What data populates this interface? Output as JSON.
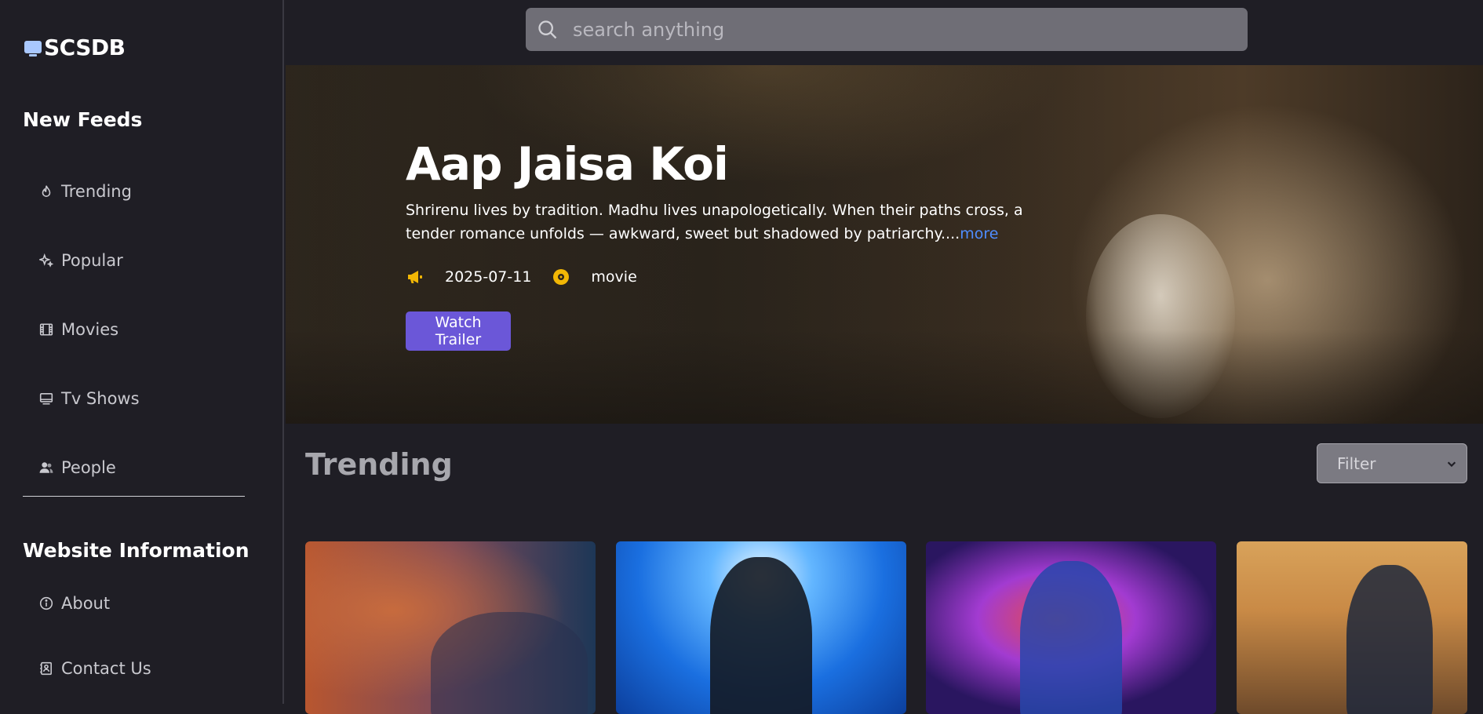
{
  "brand": {
    "name": "SCSDB"
  },
  "sidebar": {
    "feeds_title": "New Feeds",
    "items": [
      {
        "label": "Trending",
        "icon": "flame-icon"
      },
      {
        "label": "Popular",
        "icon": "sparkle-icon"
      },
      {
        "label": "Movies",
        "icon": "film-icon"
      },
      {
        "label": "Tv Shows",
        "icon": "tv-icon"
      },
      {
        "label": "People",
        "icon": "people-icon"
      }
    ],
    "info_title": "Website Information",
    "info_items": [
      {
        "label": "About",
        "icon": "info-icon"
      },
      {
        "label": "Contact Us",
        "icon": "contact-icon"
      }
    ]
  },
  "search": {
    "placeholder": "search anything"
  },
  "hero": {
    "title": "Aap Jaisa Koi",
    "description": "Shrirenu lives by tradition. Madhu lives unapologetically. When their paths cross, a tender romance unfolds — awkward, sweet but shadowed by patriarchy....",
    "more_label": "more",
    "release_date": "2025-07-11",
    "media_type": "movie",
    "watch_label": "Watch Trailer",
    "accent_color": "#6b57d8",
    "icon_color": "#f2b705"
  },
  "trending": {
    "title": "Trending",
    "filter_label": "Filter",
    "cards": [
      {
        "poster": "poster-1"
      },
      {
        "poster": "poster-2"
      },
      {
        "poster": "poster-3"
      },
      {
        "poster": "poster-4"
      }
    ]
  }
}
